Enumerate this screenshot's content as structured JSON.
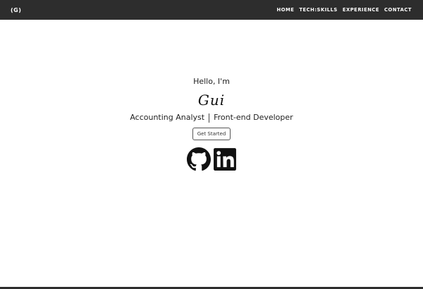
{
  "navbar": {
    "brand": "(G)",
    "links": [
      "HOME",
      "TECH:SKILLS",
      "EXPERIENCE",
      "CONTACT"
    ]
  },
  "hero": {
    "greeting": "Hello, I'm",
    "name": "Gui",
    "role_1": "Accounting Analyst",
    "role_2": "Front-end Developer",
    "cta_label": "Get Started"
  },
  "socials": [
    {
      "icon": "github-icon"
    },
    {
      "icon": "linkedin-icon"
    }
  ],
  "colors": {
    "navbar_bg": "#2d2d2d",
    "nav_text": "#ffffff",
    "page_bg": "#ffffff"
  }
}
